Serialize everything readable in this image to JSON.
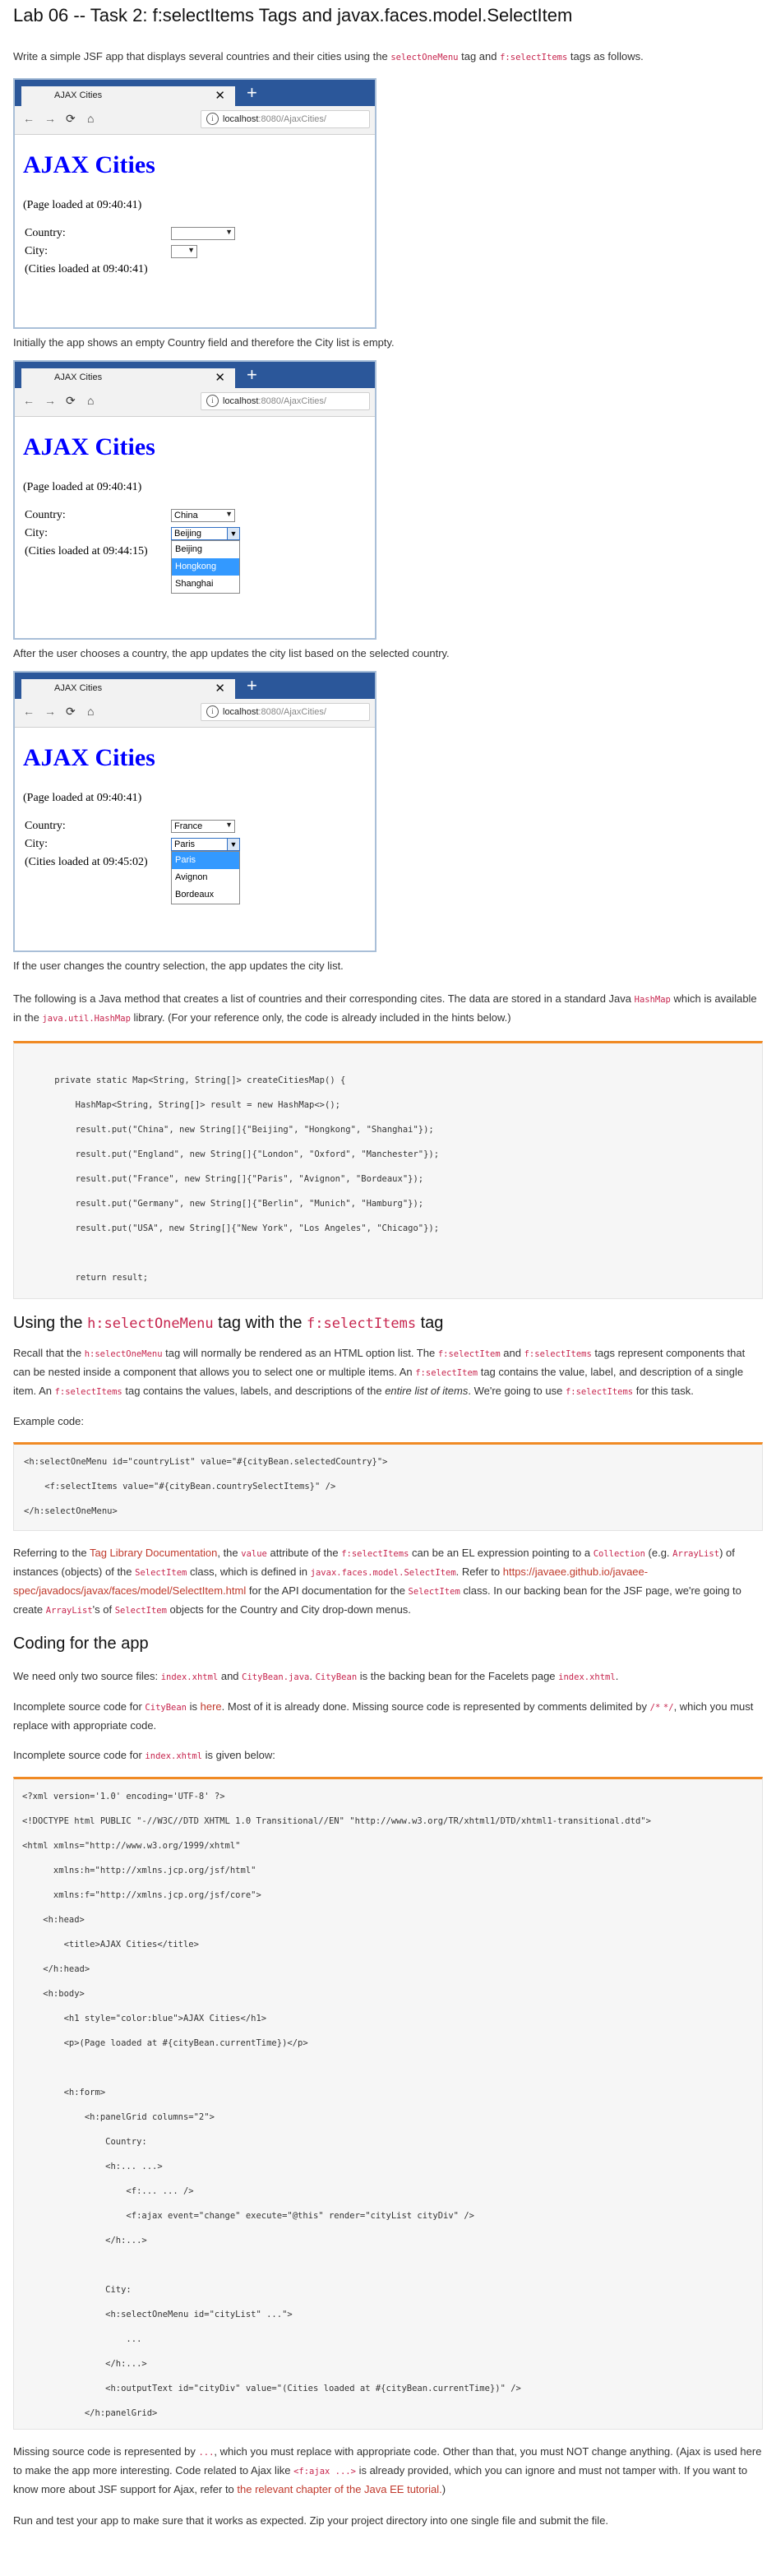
{
  "title": "Lab 06 -- Task 2: f:selectItems Tags and javax.faces.model.SelectItem",
  "intro": {
    "t1": "Write a simple JSF app that displays several countries and their cities using the ",
    "c1": "selectOneMenu",
    "t2": " tag and ",
    "c2": "f:selectItems",
    "t3": " tags as follows."
  },
  "browser": {
    "tab_title": "AJAX Cities",
    "tab_close": "✕",
    "new_tab": "+",
    "url_host": "localhost",
    "url_path": ":8080/AjaxCities/",
    "info_icon": "i",
    "back_icon": "←",
    "forward_icon": "→",
    "reload_icon": "⟳",
    "home_icon": "⌂"
  },
  "app": {
    "heading": "AJAX Cities",
    "page_loaded": "(Page loaded at 09:40:41)",
    "country_label": "Country:",
    "city_label": "City:"
  },
  "shots": [
    {
      "country": "",
      "city": "",
      "cities_loaded": "(Cities loaded at 09:40:41)",
      "options": []
    },
    {
      "country": "China",
      "city": "Beijing",
      "cities_loaded": "(Cities loaded at 09:44:15)",
      "options": [
        "Beijing",
        "Hongkong",
        "Shanghai"
      ],
      "highlight": 1
    },
    {
      "country": "France",
      "city": "Paris",
      "cities_loaded": "(Cities loaded at 09:45:02)",
      "options": [
        "Paris",
        "Avignon",
        "Bordeaux"
      ],
      "highlight": 0
    }
  ],
  "captions": [
    "Initially the app shows an empty Country field and therefore the City list is empty.",
    "After the user chooses a country, the app updates the city list based on the selected country.",
    "If the user changes the country selection, the app updates the city list."
  ],
  "java_para": {
    "t1": "The following is a Java method that creates a list of countries and their corresponding cites. The data are stored in a standard Java ",
    "c1": "HashMap",
    "t2": " which is available in the ",
    "c2": "java.util.HashMap",
    "t3": " library. (For your reference only, the code is already included in the hints below.)"
  },
  "java_code": "\n\n    private static Map<String, String[]> createCitiesMap() {\n\n        HashMap<String, String[]> result = new HashMap<>();\n\n        result.put(\"China\", new String[]{\"Beijing\", \"Hongkong\", \"Shanghai\"});\n\n        result.put(\"England\", new String[]{\"London\", \"Oxford\", \"Manchester\"});\n\n        result.put(\"France\", new String[]{\"Paris\", \"Avignon\", \"Bordeaux\"});\n\n        result.put(\"Germany\", new String[]{\"Berlin\", \"Munich\", \"Hamburg\"});\n\n        result.put(\"USA\", new String[]{\"New York\", \"Los Angeles\", \"Chicago\"});\n\n\n\n        return result;\n\n    }",
  "sec1": {
    "t1": "Using the ",
    "c1": "h:selectOneMenu",
    "t2": " tag with the ",
    "c2": "f:selectItems",
    "t3": " tag"
  },
  "recall": {
    "t1": "Recall that the ",
    "c1": "h:selectOneMenu",
    "t2": " tag will normally be rendered as an HTML option list. The ",
    "c2": "f:selectItem",
    "t3": " and ",
    "c3": "f:selectItems",
    "t4": " tags represent components that can be nested inside a component that allows you to select one or multiple items. An ",
    "c4": "f:selectItem",
    "t5": " tag contains the value, label, and description of a single item. An ",
    "c5": "f:selectItems",
    "t6": " tag contains the values, labels, and descriptions of the ",
    "em": "entire list of items",
    "t7": ". We're going to use ",
    "c6": "f:selectItems",
    "t8": " for this task."
  },
  "example_label": "Example code:",
  "example_code": "<h:selectOneMenu id=\"countryList\" value=\"#{cityBean.selectedCountry}\">\n\n    <f:selectItems value=\"#{cityBean.countrySelectItems}\" />\n\n</h:selectOneMenu>",
  "refer": {
    "t1": "Referring to the ",
    "a1": "Tag Library Documentation",
    "t2": ", the ",
    "c1": "value",
    "t3": " attribute of the ",
    "c2": "f:selectItems",
    "t4": " can be an EL expression pointing to a ",
    "c3": "Collection",
    "t5": " (e.g. ",
    "c4": "ArrayList",
    "t6": ") of instances (objects) of the ",
    "c5": "SelectItem",
    "t7": " class, which is defined in ",
    "c6": "javax.faces.model.SelectItem",
    "t8": ". Refer to ",
    "a2": "https://javaee.github.io/javaee-spec/javadocs/javax/faces/model/SelectItem.html",
    "t9": " for the API documentation for the ",
    "c7": "SelectItem",
    "t10": " class. In our backing bean for the JSF page, we're going to create ",
    "c8": "ArrayList",
    "t11": "'s of ",
    "c9": "SelectItem",
    "t12": " objects for the Country and City drop-down menus."
  },
  "sec2": "Coding for the app",
  "need": {
    "t1": "We need only two source files: ",
    "c1": "index.xhtml",
    "t2": " and ",
    "c2": "CityBean.java",
    "t3": ". ",
    "c3": "CityBean",
    "t4": " is the backing bean for the Facelets page ",
    "c4": "index.xhtml",
    "t5": "."
  },
  "incomplete": {
    "t1": "Incomplete source code for ",
    "c1": "CityBean",
    "t2": " is ",
    "a1": "here",
    "t3": ". Most of it is already done. Missing source code is represented by comments delimited by ",
    "c2": "/*",
    "t4": " ",
    "c3": "*/",
    "t5": ", which you must replace with appropriate code."
  },
  "index_label": {
    "t1": "Incomplete source code for ",
    "c1": "index.xhtml",
    "t2": " is given below:"
  },
  "xhtml_code": "<?xml version='1.0' encoding='UTF-8' ?>\n\n<!DOCTYPE html PUBLIC \"-//W3C//DTD XHTML 1.0 Transitional//EN\" \"http://www.w3.org/TR/xhtml1/DTD/xhtml1-transitional.dtd\">\n\n<html xmlns=\"http://www.w3.org/1999/xhtml\"\n\n      xmlns:h=\"http://xmlns.jcp.org/jsf/html\"\n\n      xmlns:f=\"http://xmlns.jcp.org/jsf/core\">\n\n    <h:head>\n\n        <title>AJAX Cities</title>\n\n    </h:head>\n\n    <h:body>\n\n        <h1 style=\"color:blue\">AJAX Cities</h1>\n\n        <p>(Page loaded at #{cityBean.currentTime})</p>\n\n\n\n        <h:form>\n\n            <h:panelGrid columns=\"2\">\n\n                Country:\n\n                <h:... ...>\n\n                    <f:... ... />\n\n                    <f:ajax event=\"change\" execute=\"@this\" render=\"cityList cityDiv\" />\n\n                </h:...>\n\n\n\n                City:\n\n                <h:selectOneMenu id=\"cityList\" ...\">\n\n                    ...\n\n                </h:...>\n\n                <h:outputText id=\"cityDiv\" value=\"(Cities loaded at #{cityBean.currentTime})\" />\n\n            </h:panelGrid>\n\n        </h:form>\n\n    </h:body>\n\n</html>",
  "missing": {
    "t1": "Missing source code is represented by ",
    "c1": "...",
    "t2": ", which you must replace with appropriate code. Other than that, you must NOT change anything. (Ajax is used here to make the app more interesting. Code related to Ajax like ",
    "c2": "<f:ajax ...>",
    "t3": " is already provided, which you can ignore and must not tamper with. If you want to know more about JSF support for Ajax, refer to ",
    "a1": "the relevant chapter of the Java EE tutorial.",
    "t4": ")"
  },
  "final": "Run and test your app to make sure that it works as expected. Zip your project directory into one single file and submit the file."
}
